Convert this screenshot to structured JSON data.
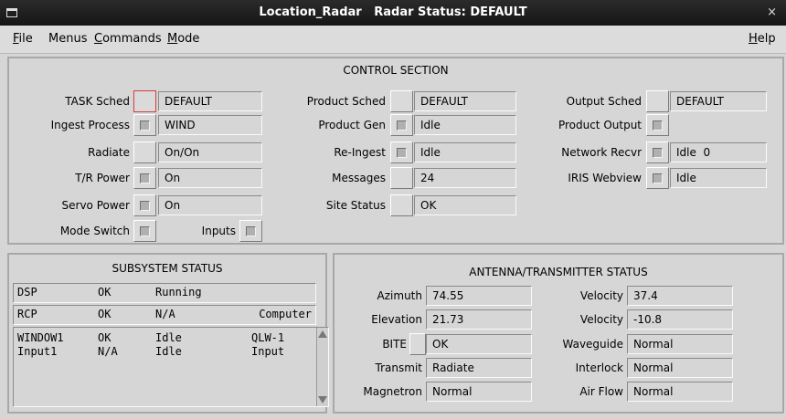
{
  "window": {
    "title": "Location_Radar   Radar Status: DEFAULT",
    "close": "×"
  },
  "menubar": {
    "file": "File",
    "file_u": "F",
    "menus": "Menus",
    "commands": "Commands",
    "commands_u": "C",
    "mode": "Mode",
    "mode_u": "M",
    "help": "Help",
    "help_u": "H"
  },
  "control": {
    "title": "CONTROL SECTION",
    "task_sched": {
      "label": "TASK Sched",
      "value": "DEFAULT"
    },
    "ingest_process": {
      "label": "Ingest Process",
      "value": "WIND"
    },
    "radiate": {
      "label": "Radiate",
      "value": "On/On"
    },
    "tr_power": {
      "label": "T/R Power",
      "value": "On"
    },
    "servo_power": {
      "label": "Servo Power",
      "value": "On"
    },
    "mode_switch": {
      "label": "Mode Switch"
    },
    "inputs": {
      "label": "Inputs"
    },
    "product_sched": {
      "label": "Product Sched",
      "value": "DEFAULT"
    },
    "product_gen": {
      "label": "Product Gen",
      "value": "Idle"
    },
    "re_ingest": {
      "label": "Re-Ingest",
      "value": "Idle"
    },
    "messages": {
      "label": "Messages",
      "value": "24"
    },
    "site_status": {
      "label": "Site Status",
      "value": "OK"
    },
    "output_sched": {
      "label": "Output Sched",
      "value": "DEFAULT"
    },
    "product_output": {
      "label": "Product Output"
    },
    "network_recvr": {
      "label": "Network Recvr",
      "value": "Idle  0"
    },
    "iris_webview": {
      "label": "IRIS Webview",
      "value": "Idle"
    }
  },
  "subsystem": {
    "title": "SUBSYSTEM STATUS",
    "rows": [
      [
        "DSP",
        "OK",
        "Running",
        ""
      ],
      [
        "RCP",
        "OK",
        "N/A",
        "Computer"
      ],
      [
        "WINDOW1",
        "OK",
        "Idle",
        "QLW-1"
      ],
      [
        "Input1",
        "N/A",
        "Idle",
        "Input"
      ]
    ]
  },
  "antenna": {
    "title": "ANTENNA/TRANSMITTER STATUS",
    "azimuth": {
      "label": "Azimuth",
      "value": "74.55"
    },
    "elevation": {
      "label": "Elevation",
      "value": "21.73"
    },
    "bite": {
      "label": "BITE",
      "value": "OK"
    },
    "transmit": {
      "label": "Transmit",
      "value": "Radiate"
    },
    "magnetron": {
      "label": "Magnetron",
      "value": "Normal"
    },
    "velocity1": {
      "label": "Velocity",
      "value": "37.4"
    },
    "velocity2": {
      "label": "Velocity",
      "value": "-10.8"
    },
    "waveguide": {
      "label": "Waveguide",
      "value": "Normal"
    },
    "interlock": {
      "label": "Interlock",
      "value": "Normal"
    },
    "air_flow": {
      "label": "Air Flow",
      "value": "Normal"
    }
  }
}
